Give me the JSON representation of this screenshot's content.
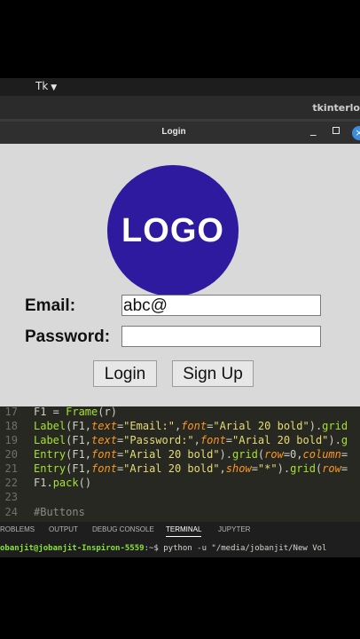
{
  "system_bar": {
    "app_menu": "Tk"
  },
  "editor_window": {
    "title": "tkinterlo"
  },
  "tk_window": {
    "title": "Login",
    "minimize_glyph": "_",
    "close_glyph": "×",
    "logo_text": "LOGO",
    "email_label": "Email:",
    "email_value": "abc@",
    "password_label": "Password:",
    "password_value": "",
    "login_button": "Login",
    "signup_button": "Sign Up"
  },
  "code": {
    "line_numbers": [
      "17",
      "18",
      "19",
      "20",
      "21",
      "22",
      "23",
      "24"
    ],
    "l17": {
      "a": "F1 = ",
      "b": "Frame",
      "c": "(r)"
    },
    "l18": {
      "a": "Label",
      "b": "(F1,",
      "c": "text",
      "d": "=",
      "e": "\"Email:\"",
      "f": ",",
      "g": "font",
      "h": "=",
      "i": "\"Arial 20 bold\"",
      "j": ").",
      "k": "grid"
    },
    "l19": {
      "a": "Label",
      "b": "(F1,",
      "c": "text",
      "d": "=",
      "e": "\"Password:\"",
      "f": ",",
      "g": "font",
      "h": "=",
      "i": "\"Arial 20 bold\"",
      "j": ").",
      "k": "g"
    },
    "l20": {
      "a": "Entry",
      "b": "(F1,",
      "c": "font",
      "d": "=",
      "e": "\"Arial 20 bold\"",
      "f": ").",
      "g": "grid",
      "h": "(",
      "i": "row",
      "j": "=0,",
      "k": "column",
      "l": "="
    },
    "l21": {
      "a": "Entry",
      "b": "(F1,",
      "c": "font",
      "d": "=",
      "e": "\"Arial 20 bold\"",
      "f": ",",
      "g": "show",
      "h": "=",
      "i": "\"*\"",
      "j": ").",
      "k": "grid",
      "l": "(",
      "m": "row",
      "n": "="
    },
    "l22": {
      "a": "F1.",
      "b": "pack",
      "c": "()"
    },
    "l24": {
      "a": "#Buttons"
    }
  },
  "panel": {
    "tabs": [
      "ROBLEMS",
      "OUTPUT",
      "DEBUG CONSOLE",
      "TERMINAL",
      "JUPYTER"
    ],
    "active_tab": "TERMINAL"
  },
  "terminal": {
    "prompt": "obanjit@jobanjit-Inspiron-5559",
    "path": ":~$",
    "command": " python -u \"/media/jobanjit/New Vol"
  }
}
